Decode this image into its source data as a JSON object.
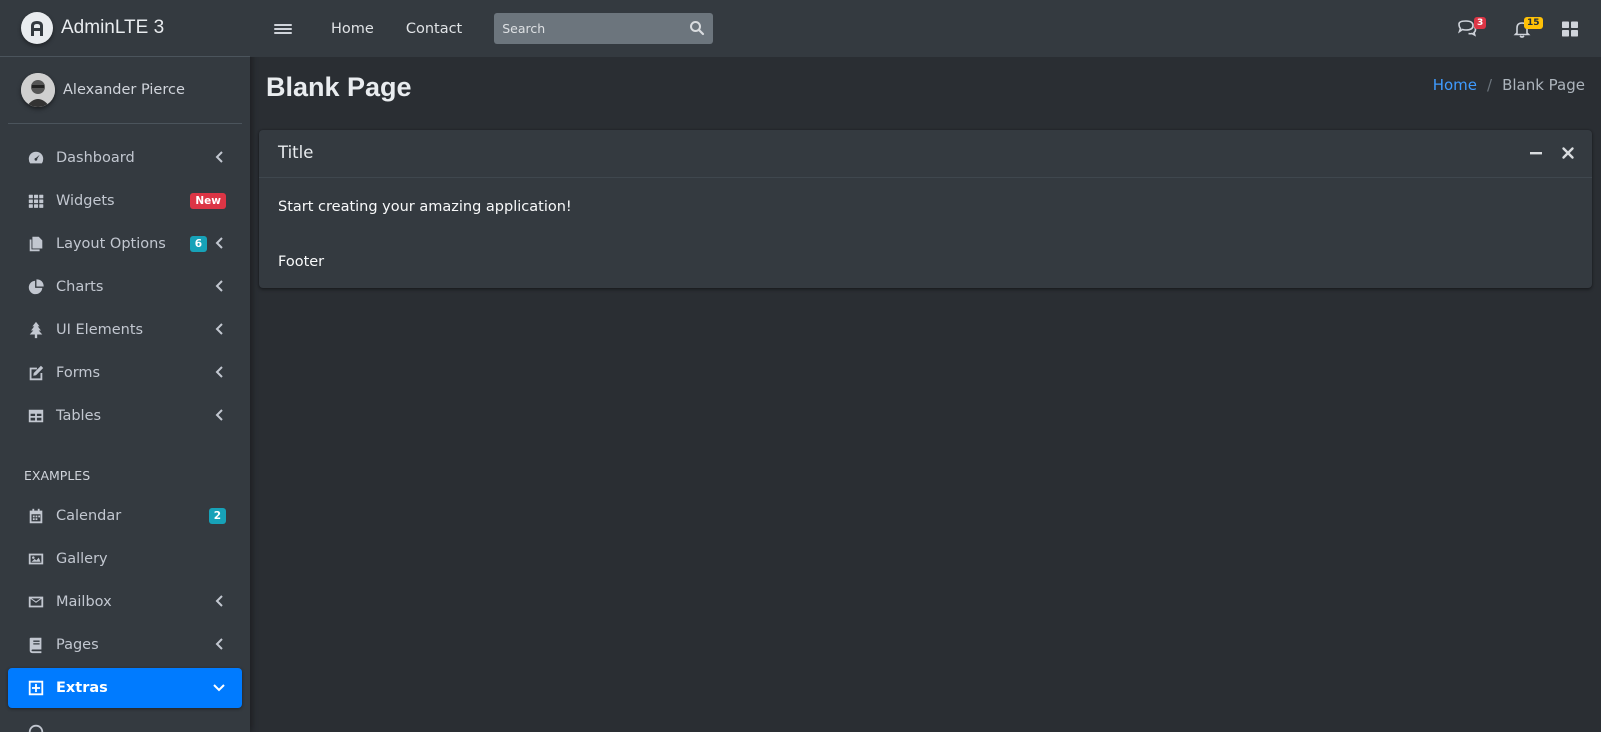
{
  "brand": {
    "title": "AdminLTE 3"
  },
  "user": {
    "name": "Alexander Pierce"
  },
  "sidebar": {
    "items": [
      {
        "label": "Dashboard",
        "icon": "tachometer-icon",
        "has_chevron": true
      },
      {
        "label": "Widgets",
        "icon": "th-grid-icon",
        "badge": "New",
        "badge_color": "#dc3545"
      },
      {
        "label": "Layout Options",
        "icon": "copy-icon",
        "badge": "6",
        "badge_color": "#17a2b8",
        "has_chevron": true
      },
      {
        "label": "Charts",
        "icon": "pie-chart-icon",
        "has_chevron": true
      },
      {
        "label": "UI Elements",
        "icon": "tree-icon",
        "has_chevron": true
      },
      {
        "label": "Forms",
        "icon": "edit-icon",
        "has_chevron": true
      },
      {
        "label": "Tables",
        "icon": "table-icon",
        "has_chevron": true
      }
    ],
    "header": "EXAMPLES",
    "examples": [
      {
        "label": "Calendar",
        "icon": "calendar-icon",
        "badge": "2",
        "badge_color": "#17a2b8"
      },
      {
        "label": "Gallery",
        "icon": "image-icon"
      },
      {
        "label": "Mailbox",
        "icon": "envelope-icon",
        "has_chevron": true
      },
      {
        "label": "Pages",
        "icon": "book-icon",
        "has_chevron": true
      },
      {
        "label": "Extras",
        "icon": "plus-square-icon",
        "has_chevron": true,
        "active": true
      }
    ]
  },
  "topbar": {
    "links": [
      "Home",
      "Contact"
    ],
    "search_placeholder": "Search",
    "messages_count": "3",
    "notifications_count": "15"
  },
  "page": {
    "title": "Blank Page",
    "breadcrumb": {
      "home": "Home",
      "current": "Blank Page"
    }
  },
  "card": {
    "title": "Title",
    "body": "Start creating your amazing application!",
    "footer": "Footer"
  },
  "colors": {
    "accent": "#007bff",
    "sidebar_bg": "#343a40",
    "content_bg": "#2a2e33",
    "danger": "#dc3545",
    "info": "#17a2b8",
    "warning": "#ffc107"
  }
}
